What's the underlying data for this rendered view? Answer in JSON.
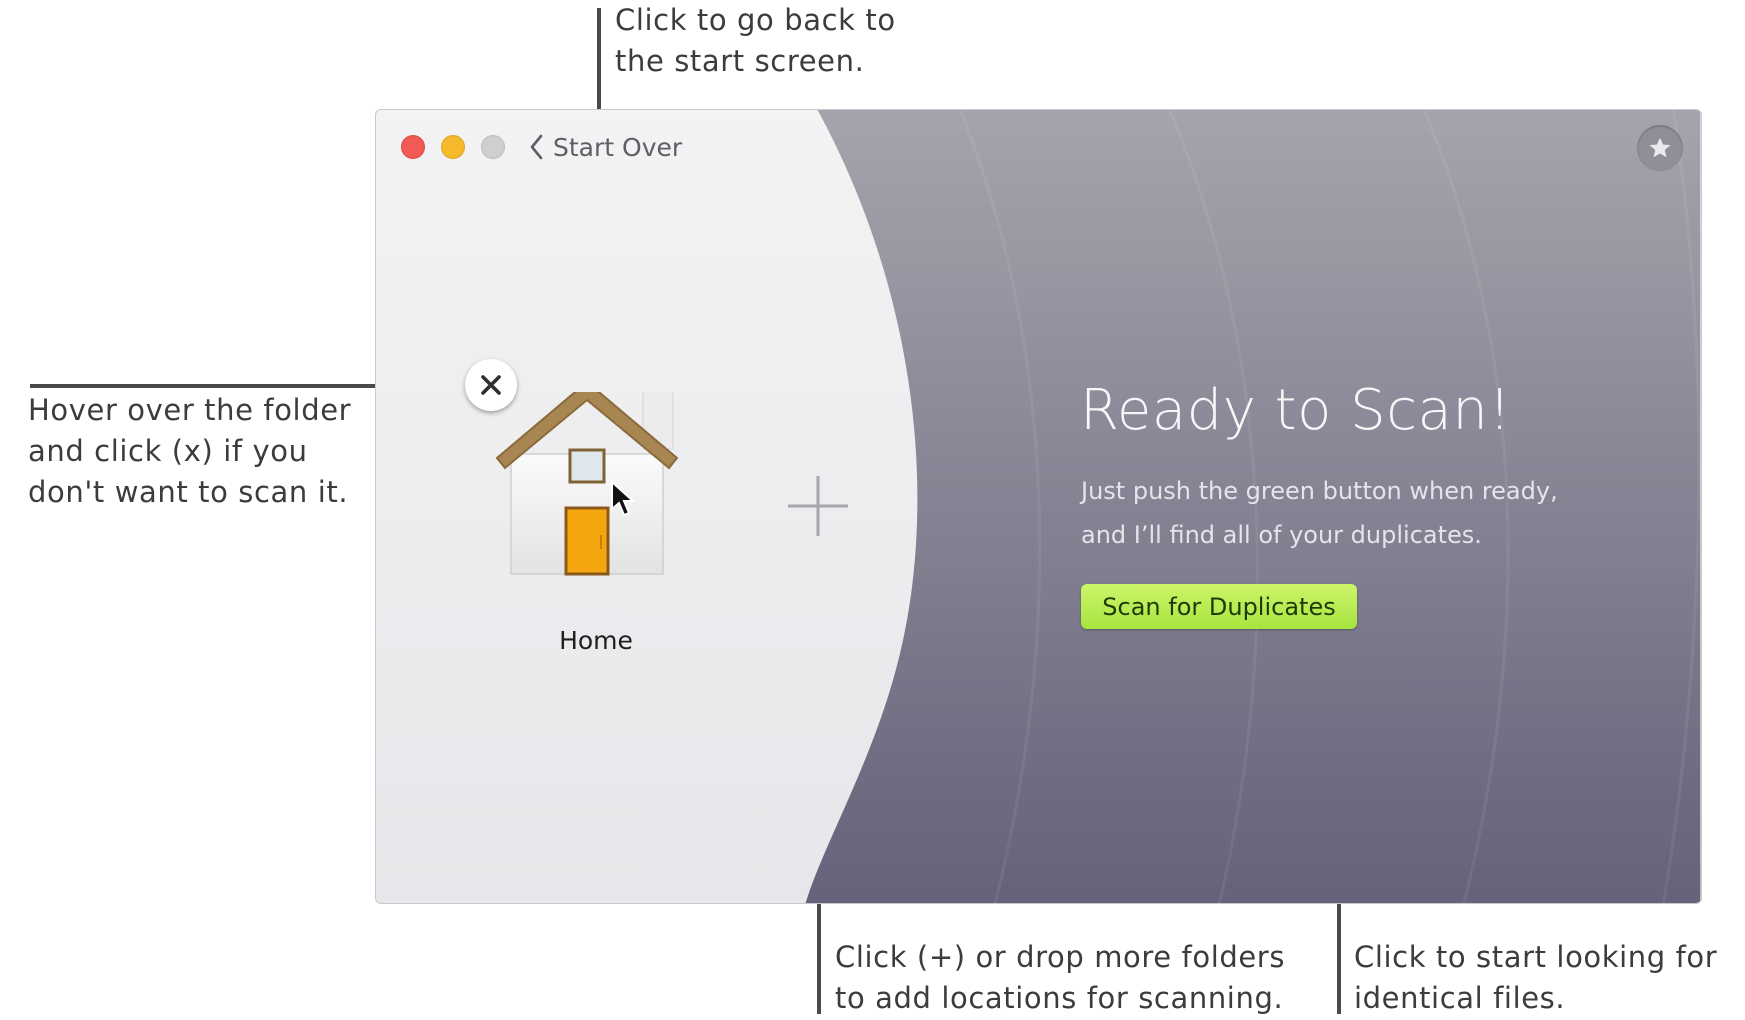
{
  "window": {
    "back_label": "Start Over",
    "folder_label": "Home",
    "ready_title": "Ready to Scan!",
    "ready_subtitle_lines": [
      "Just push the green button when ready,",
      "and I’ll find all of your duplicates."
    ],
    "scan_button_label": "Scan for Duplicates",
    "icons": [
      "close-window-icon",
      "minimize-window-icon",
      "zoom-window-icon",
      "chevron-left-icon",
      "star-icon",
      "remove-x-icon",
      "home-folder-icon",
      "add-plus-icon",
      "mouse-cursor-icon"
    ],
    "colors": {
      "accent_green": "#b3ea4f",
      "dark_pane": "#6e6b7c",
      "light_pane": "#eeeef0"
    }
  },
  "annotations": {
    "start_over": [
      "Click to go back to",
      "the start screen."
    ],
    "remove_folder": [
      "Hover over the folder",
      "and click (x) if you",
      "don't want to scan it."
    ],
    "add_locations": [
      "Click (+) or drop more folders",
      "to add locations for scanning."
    ],
    "start_scan": [
      "Click to start looking for",
      "identical files."
    ]
  }
}
